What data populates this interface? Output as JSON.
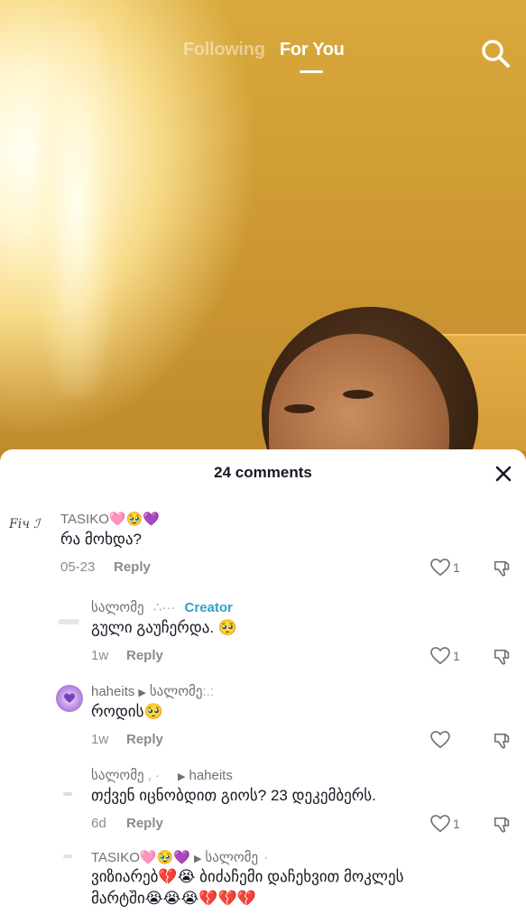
{
  "nav": {
    "tabs": [
      {
        "label": "Following"
      },
      {
        "label": "For You"
      }
    ],
    "search_icon": "search-icon"
  },
  "sheet": {
    "title": "24 comments",
    "close_icon": "close-icon"
  },
  "comments": [
    {
      "username": "TASIKO🩷🥹💜",
      "text": "რა მოხდა?",
      "date": "05-23",
      "reply_label": "Reply",
      "likes": "1",
      "avatar_text": "Fіч ℐ"
    },
    {
      "username": "სალომე",
      "creator_label": "Creator",
      "text": "გული გაუჩერდა. 🥺",
      "date": "1w",
      "reply_label": "Reply",
      "likes": "1"
    },
    {
      "username": "haheits",
      "reply_to": "სალომე",
      "text": "როდის🥺",
      "date": "1w",
      "reply_label": "Reply",
      "likes": ""
    },
    {
      "username": "სალომე",
      "reply_to": "haheits",
      "text": "თქვენ იცნობდით გიოს? 23 დეკემბერს.",
      "date": "6d",
      "reply_label": "Reply",
      "likes": "1"
    },
    {
      "username": "TASIKO🩷🥹💜",
      "reply_to": "სალომე",
      "text_line1": "ვიზიარებ💔😭 ბიძაჩემი დაჩეხვით მოკლეს",
      "text_line2": "მარტში😭😭😭💔💔💔"
    }
  ]
}
